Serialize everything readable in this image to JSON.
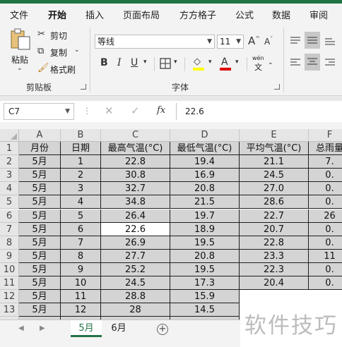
{
  "ribbon_tabs": [
    "文件",
    "开始",
    "插入",
    "页面布局",
    "方方格子",
    "公式",
    "数据",
    "审阅"
  ],
  "active_tab": "开始",
  "clipboard": {
    "paste_label": "粘贴",
    "cut_label": "剪切",
    "copy_label": "复制",
    "format_painter_label": "格式刷",
    "group_label": "剪贴板"
  },
  "font": {
    "font_name": "等线",
    "font_size": "11",
    "grow_label": "A",
    "shrink_label": "A",
    "bold_label": "B",
    "italic_label": "I",
    "underline_label": "U",
    "fill_color": "#FFFF00",
    "font_color": "#E00000",
    "wen_label": "wén",
    "wen_char": "文",
    "group_label": "字体"
  },
  "formula_bar": {
    "name_box": "C7",
    "fx_label": "fx",
    "value": "22.6"
  },
  "columns": [
    "A",
    "B",
    "C",
    "D",
    "E",
    "F"
  ],
  "rows": [
    "1",
    "2",
    "3",
    "4",
    "5",
    "6",
    "7",
    "8",
    "9",
    "10",
    "11",
    "12",
    "13"
  ],
  "table": {
    "headers": [
      "月份",
      "日期",
      "最高气温(°C)",
      "最低气温(°C)",
      "平均气温(°C)",
      "总雨量"
    ],
    "data": [
      [
        "5月",
        "1",
        "22.8",
        "19.4",
        "21.1",
        "7."
      ],
      [
        "5月",
        "2",
        "30.8",
        "16.9",
        "24.5",
        "0."
      ],
      [
        "5月",
        "3",
        "32.7",
        "20.8",
        "27.0",
        "0."
      ],
      [
        "5月",
        "4",
        "34.8",
        "21.5",
        "28.6",
        "0."
      ],
      [
        "5月",
        "5",
        "26.4",
        "19.7",
        "22.7",
        "26"
      ],
      [
        "5月",
        "6",
        "22.6",
        "18.9",
        "20.7",
        "0."
      ],
      [
        "5月",
        "7",
        "26.9",
        "19.5",
        "22.8",
        "0."
      ],
      [
        "5月",
        "8",
        "27.7",
        "20.8",
        "23.3",
        "11"
      ],
      [
        "5月",
        "9",
        "25.2",
        "19.5",
        "22.3",
        "0."
      ],
      [
        "5月",
        "10",
        "24.5",
        "17.3",
        "20.4",
        "0."
      ],
      [
        "5月",
        "11",
        "28.8",
        "15.9",
        "",
        ""
      ],
      [
        "5月",
        "12",
        "28",
        "14.5",
        "",
        ""
      ]
    ]
  },
  "sheets": [
    "5月",
    "6月"
  ],
  "active_sheet": "5月",
  "watermark": "软件技巧"
}
